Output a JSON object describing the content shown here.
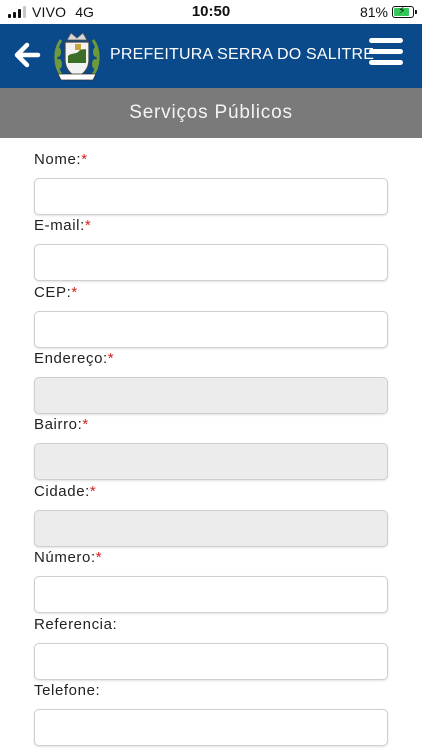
{
  "status_bar": {
    "carrier": "VIVO",
    "network": "4G",
    "time": "10:50",
    "battery": "81%",
    "battery_level": 0.81,
    "battery_color": "#34c759"
  },
  "header": {
    "title": "PREFEITURA SERRA DO SALITRE",
    "back_icon": "arrow-left-icon",
    "menu_icon": "hamburger-menu-icon",
    "logo_icon": "city-coat-of-arms-logo",
    "background": "#0b4a8a"
  },
  "section": {
    "title": "Serviços Públicos",
    "background": "#7a7a7a"
  },
  "form": {
    "required_marker": "*",
    "fields": [
      {
        "label": "Nome:",
        "required": true,
        "value": "",
        "editable": true
      },
      {
        "label": "E-mail:",
        "required": true,
        "value": "",
        "editable": true
      },
      {
        "label": "CEP:",
        "required": true,
        "value": "",
        "editable": true
      },
      {
        "label": "Endereço:",
        "required": true,
        "value": "",
        "editable": false
      },
      {
        "label": "Bairro:",
        "required": true,
        "value": "",
        "editable": false
      },
      {
        "label": "Cidade:",
        "required": true,
        "value": "",
        "editable": false
      },
      {
        "label": "Número:",
        "required": true,
        "value": "",
        "editable": true
      },
      {
        "label": "Referencia:",
        "required": false,
        "value": "",
        "editable": true
      },
      {
        "label": "Telefone:",
        "required": false,
        "value": "",
        "editable": true
      }
    ]
  }
}
